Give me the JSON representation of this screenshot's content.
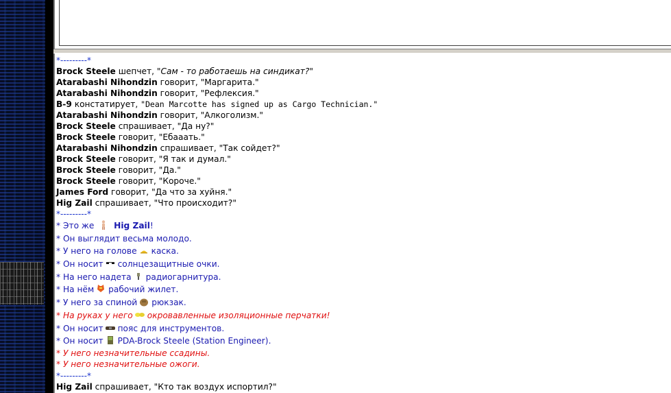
{
  "chat": {
    "separator": "*---------*",
    "messages": [
      {
        "speaker": "Brock Steele",
        "verb": "шепчет,",
        "text": "\"Сам - то работаешь на синдикат?\"",
        "style": "italic"
      },
      {
        "speaker": "Atarabashi Nihondzin",
        "verb": "говорит,",
        "text": "\"Маргарита.\"",
        "style": "normal"
      },
      {
        "speaker": "Atarabashi Nihondzin",
        "verb": "говорит,",
        "text": "\"Рефлексия.\"",
        "style": "normal"
      },
      {
        "speaker": "B-9",
        "verb": "констатирует,",
        "text": "\"Dean Marcotte has signed up as Cargo Technician.\"",
        "style": "mono"
      },
      {
        "speaker": "Atarabashi Nihondzin",
        "verb": "говорит,",
        "text": "\"Алкоголизм.\"",
        "style": "normal"
      },
      {
        "speaker": "Brock Steele",
        "verb": "спрашивает,",
        "text": "\"Да ну?\"",
        "style": "normal"
      },
      {
        "speaker": "Brock Steele",
        "verb": "говорит,",
        "text": "\"Ебааать.\"",
        "style": "normal"
      },
      {
        "speaker": "Atarabashi Nihondzin",
        "verb": "спрашивает,",
        "text": "\"Так сойдет?\"",
        "style": "normal"
      },
      {
        "speaker": "Brock Steele",
        "verb": "говорит,",
        "text": "\"Я так и думал.\"",
        "style": "normal"
      },
      {
        "speaker": "Brock Steele",
        "verb": "говорит,",
        "text": "\"Да.\"",
        "style": "normal"
      },
      {
        "speaker": "Brock Steele",
        "verb": "говорит,",
        "text": "\"Короче.\"",
        "style": "normal"
      },
      {
        "speaker": "James Ford",
        "verb": "говорит,",
        "text": "\"Да что за хуйня.\"",
        "style": "normal"
      },
      {
        "speaker": "Hig Zail",
        "verb": "спрашивает,",
        "text": "\"Что происходит?\"",
        "style": "normal"
      }
    ],
    "examine": {
      "line1_prefix": "* Это же",
      "line1_name": "Hig Zail",
      "line1_suffix": "!",
      "line2": "* Он выглядит весьма молодо.",
      "items": [
        {
          "prefix": "* У него на голове",
          "item": "каска.",
          "icon": "hardhat-icon",
          "red": false
        },
        {
          "prefix": "* Он носит",
          "item": "солнцезащитные очки.",
          "icon": "sunglasses-icon",
          "red": false
        },
        {
          "prefix": "* На него надета",
          "item": "радиогарнитура.",
          "icon": "headset-icon",
          "red": false
        },
        {
          "prefix": "* На нём",
          "item": "рабочий жилет.",
          "icon": "vest-icon",
          "red": false
        },
        {
          "prefix": "* У него за спиной",
          "item": "рюкзак.",
          "icon": "backpack-icon",
          "red": false
        },
        {
          "prefix": "* На руках у него",
          "item": "окровавленные изоляционные перчатки!",
          "icon": "gloves-icon",
          "red": true
        },
        {
          "prefix": "* Он носит",
          "item": "пояс для инструментов.",
          "icon": "toolbelt-icon",
          "red": false
        },
        {
          "prefix": "* Он носит",
          "item": "PDA-Brock Steele (Station Engineer).",
          "icon": "pda-icon",
          "red": false
        }
      ],
      "injury1": "* У него незначительные ссадины.",
      "injury2": "* У него незначительные ожоги."
    },
    "last": {
      "speaker": "Hig Zail",
      "verb": "спрашивает,",
      "text": "\"Кто так воздух испортил?\""
    }
  }
}
